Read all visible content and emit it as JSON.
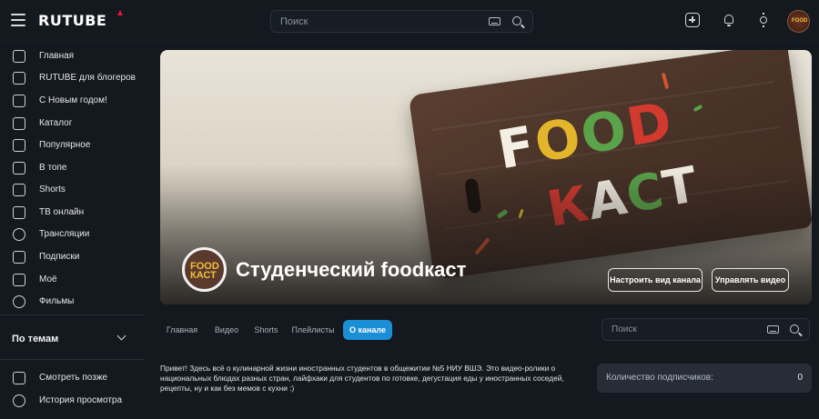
{
  "header": {
    "logo": "RUTUBE",
    "search_placeholder": "Поиск"
  },
  "sidebar": {
    "items": [
      {
        "label": "Главная",
        "icon": "home-icon"
      },
      {
        "label": "RUTUBE для блогеров",
        "icon": "rutube-s-icon"
      },
      {
        "label": "С Новым годом!",
        "icon": "calendar-gift-icon"
      },
      {
        "label": "Каталог",
        "icon": "grid-icon"
      },
      {
        "label": "Популярное",
        "icon": "lightning-icon"
      },
      {
        "label": "В топе",
        "icon": "rocket-icon"
      },
      {
        "label": "Shorts",
        "icon": "shorts-icon"
      },
      {
        "label": "ТВ онлайн",
        "icon": "tv-icon"
      },
      {
        "label": "Трансляции",
        "icon": "broadcast-icon"
      },
      {
        "label": "Подписки",
        "icon": "subscriptions-icon"
      },
      {
        "label": "Моё",
        "icon": "my-icon"
      },
      {
        "label": "Фильмы",
        "icon": "film-icon"
      }
    ],
    "topics_label": "По темам",
    "bottom_items": [
      {
        "label": "Смотреть позже",
        "icon": "bookmark-icon"
      },
      {
        "label": "История просмотра",
        "icon": "history-icon"
      }
    ]
  },
  "banner": {
    "word1": [
      "F",
      "O",
      "O",
      "D"
    ],
    "word2": [
      "К",
      "А",
      "С",
      "Т"
    ],
    "channel_avatar_text": "FOOD КАСТ",
    "avatar_text": "FOOD"
  },
  "channel": {
    "name": "Студенческий foodкаст",
    "customize_button": "Настроить вид канала",
    "manage_button": "Управлять видео"
  },
  "tabs": [
    "Главная",
    "Видео",
    "Shorts",
    "Плейлисты",
    "О канале"
  ],
  "active_tab": "О канале",
  "channel_search_placeholder": "Поиск",
  "description": "Привет! Здесь всё о кулинарной жизни иностранных студентов в общежитии №5 НИУ ВШЭ. Это видео-ролики о национальных блюдах разных стран, лайфхаки для студентов по готовке, дегустация еды у иностранных соседей, рецепты, ну и как без мемов с кухни :)",
  "subscribers": {
    "label": "Количество подписчиков:",
    "value": "0"
  },
  "colors": {
    "background": "#14191f",
    "accent": "#1b8fd6",
    "logo_mark": "#ed143b"
  }
}
